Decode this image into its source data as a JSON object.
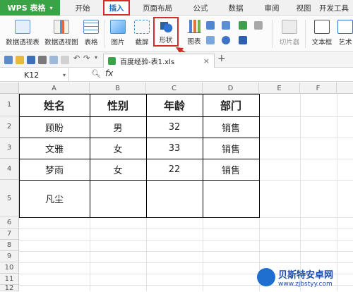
{
  "app": {
    "badge": "WPS 表格"
  },
  "tabs": [
    {
      "label": "开始"
    },
    {
      "label": "插入"
    },
    {
      "label": "页面布局"
    },
    {
      "label": "公式"
    },
    {
      "label": "数据"
    },
    {
      "label": "审阅"
    },
    {
      "label": "视图"
    },
    {
      "label": "开发工具"
    }
  ],
  "ribbon": {
    "pivot_table": "数据透视表",
    "pivot_chart": "数据透视图",
    "table": "表格",
    "picture": "图片",
    "screenshot": "截屏",
    "shapes": "形状",
    "chart": "图表",
    "slicer": "切片器",
    "textbox": "文本框",
    "art": "艺术"
  },
  "document": {
    "tab_name": "百度经验-表1.xls"
  },
  "formula_bar": {
    "cell_ref": "K12",
    "fx": "fx"
  },
  "grid": {
    "columns": [
      "A",
      "B",
      "C",
      "D",
      "E",
      "F"
    ],
    "rows": [
      "1",
      "2",
      "3",
      "4",
      "5",
      "6",
      "7",
      "8",
      "9",
      "10",
      "11",
      "12"
    ],
    "header": [
      "姓名",
      "性别",
      "年龄",
      "部门"
    ],
    "data": [
      [
        "顾盼",
        "男",
        "32",
        "销售"
      ],
      [
        "文雅",
        "女",
        "33",
        "销售"
      ],
      [
        "梦雨",
        "女",
        "22",
        "销售"
      ],
      [
        "凡尘",
        "",
        "",
        ""
      ]
    ]
  },
  "watermark": {
    "name": "贝斯特安卓网",
    "url": "www.zjbstyy.com"
  },
  "colors": {
    "wps_green": "#3aa345",
    "highlight_red": "#d62b2b",
    "active_blue": "#1f6ed4"
  }
}
